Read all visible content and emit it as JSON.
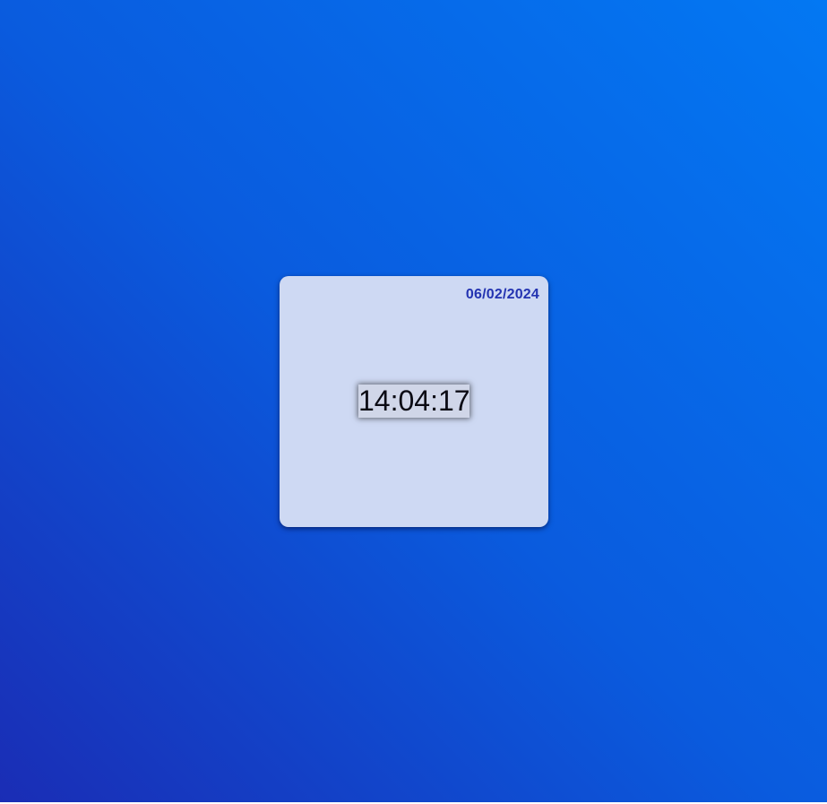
{
  "clock": {
    "date": "06/02/2024",
    "time": "14:04:17"
  },
  "colors": {
    "background_gradient_start": "#1a2db5",
    "background_gradient_end": "#0378f3",
    "card_background": "#ced9f3",
    "date_text": "#2333b1",
    "time_text": "#0b0b14"
  }
}
